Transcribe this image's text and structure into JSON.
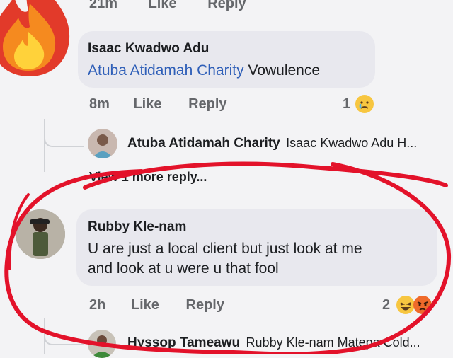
{
  "top_meta": {
    "time": "21m",
    "like": "Like",
    "reply": "Reply"
  },
  "comment1": {
    "author": "Isaac Kwadwo Adu",
    "mention": "Atuba Atidamah Charity",
    "text": "Vowulence",
    "time": "8m",
    "like": "Like",
    "reply": "Reply",
    "reaction_count": "1"
  },
  "reply_preview1": {
    "author": "Atuba Atidamah Charity",
    "snippet": "Isaac Kwadwo Adu H..."
  },
  "view_more": "View 1 more reply...",
  "comment2": {
    "author": "Rubby Kle-nam",
    "line1": "U are just a local client but just look at me",
    "line2": "and look at u were u that fool",
    "time": "2h",
    "like": "Like",
    "reply": "Reply",
    "reaction_count": "2"
  },
  "reply_preview2": {
    "author": "Hyssop Tameawu",
    "snippet": "Rubby Kle-nam Matepa Cold..."
  },
  "colors": {
    "annotation": "#e3122a",
    "link": "#2f5fb8"
  }
}
